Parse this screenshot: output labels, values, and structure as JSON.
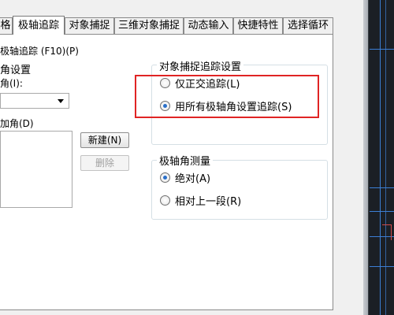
{
  "tabs": [
    {
      "label": "格"
    },
    {
      "label": "极轴追踪",
      "active": true
    },
    {
      "label": "对象捕捉"
    },
    {
      "label": "三维对象捕捉"
    },
    {
      "label": "动态输入"
    },
    {
      "label": "快捷特性"
    },
    {
      "label": "选择循环"
    }
  ],
  "polar": {
    "enable_label": "极轴追踪 (F10)(P)",
    "settings_title": "角设置",
    "increment_label": "角(I):",
    "additional_label": "加角(D)",
    "new_button": "新建(N)",
    "delete_button": "删除"
  },
  "snap_tracking": {
    "title": "对象捕捉追踪设置",
    "options": [
      {
        "label": "仅正交追踪(L)",
        "checked": false
      },
      {
        "label": "用所有极轴角设置追踪(S)",
        "checked": true
      }
    ]
  },
  "measurement": {
    "title": "极轴角测量",
    "options": [
      {
        "label": "绝对(A)",
        "checked": true
      },
      {
        "label": "相对上一段(R)",
        "checked": false
      }
    ]
  },
  "colors": {
    "highlight": "#e02424",
    "radio_dot": "#2a6fc9",
    "cad_line": "#3c7fd6"
  }
}
